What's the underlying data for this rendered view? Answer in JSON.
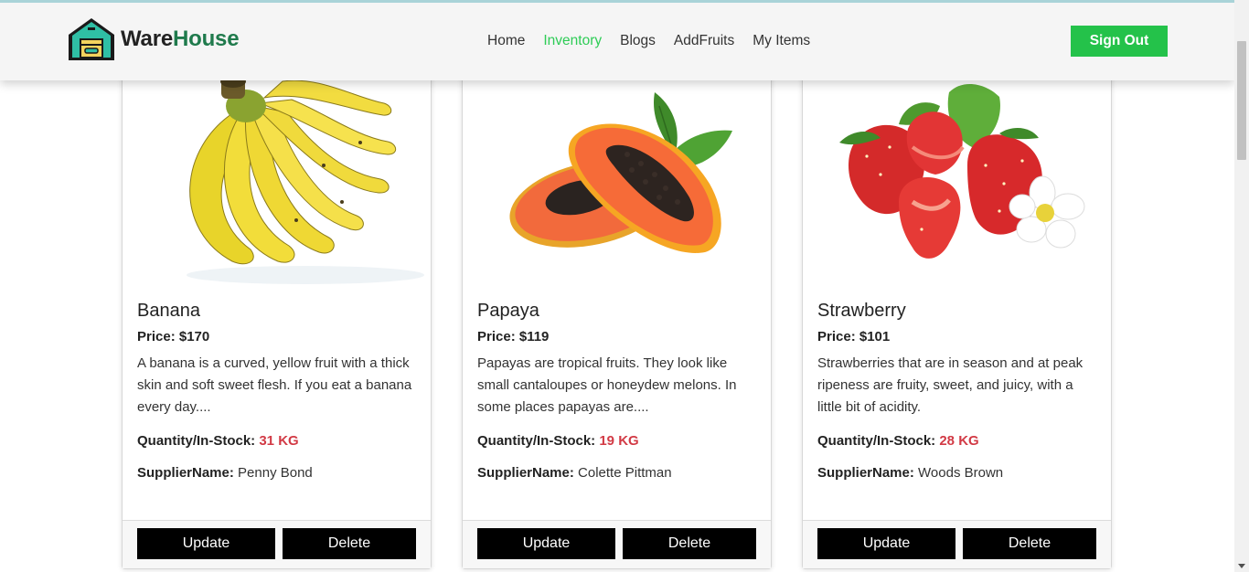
{
  "brand": {
    "name_part1": "Ware",
    "name_part2": "House"
  },
  "nav": {
    "links": [
      {
        "label": "Home",
        "active": false
      },
      {
        "label": "Inventory",
        "active": true
      },
      {
        "label": "Blogs",
        "active": false
      },
      {
        "label": "AddFruits",
        "active": false
      },
      {
        "label": "My Items",
        "active": false
      }
    ],
    "signout_label": "Sign Out"
  },
  "colors": {
    "accent_green": "#24c24a",
    "brand_green": "#1f7a4c",
    "quantity_red": "#d23a45"
  },
  "cards": [
    {
      "name": "Banana",
      "price": "Price: $170",
      "description": "A banana is a curved, yellow fruit with a thick skin and soft sweet flesh. If you eat a banana every day....",
      "quantity_label": "Quantity/In-Stock:",
      "quantity_value": "31 KG",
      "supplier_label": "SupplierName:",
      "supplier_value": "Penny Bond",
      "update_label": "Update",
      "delete_label": "Delete"
    },
    {
      "name": "Papaya",
      "price": "Price: $119",
      "description": "Papayas are tropical fruits. They look like small cantaloupes or honeydew melons. In some places papayas are....",
      "quantity_label": "Quantity/In-Stock:",
      "quantity_value": "19 KG",
      "supplier_label": "SupplierName:",
      "supplier_value": "Colette Pittman",
      "update_label": "Update",
      "delete_label": "Delete"
    },
    {
      "name": "Strawberry",
      "price": "Price: $101",
      "description": "Strawberries that are in season and at peak ripeness are fruity, sweet, and juicy, with a little bit of acidity.",
      "quantity_label": "Quantity/In-Stock:",
      "quantity_value": "28 KG",
      "supplier_label": "SupplierName:",
      "supplier_value": "Woods Brown",
      "update_label": "Update",
      "delete_label": "Delete"
    }
  ]
}
